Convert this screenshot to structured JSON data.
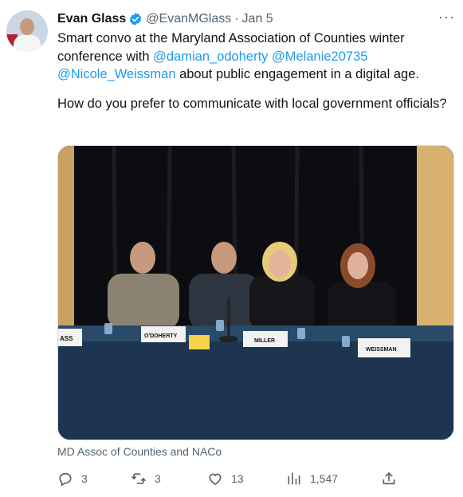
{
  "tweet": {
    "author_name": "Evan Glass",
    "handle": "@EvanMGlass",
    "separator": "·",
    "date": "Jan 5",
    "text_line1": "Smart convo at the Maryland Association of Counties winter conference with ",
    "mention1": "@damian_odoherty",
    "mention2": "@Melanie20735",
    "mention3": "@Nicole_Weissman",
    "text_after_mentions": " about public engagement in a digital age.",
    "question": "How do you prefer to communicate with local government officials?",
    "more_label": "···"
  },
  "media": {
    "nameplates": [
      "ASS",
      "O'DOHERTY",
      "MILLER",
      "WEISSMAN"
    ],
    "caption": "MD Assoc of Counties and NACo"
  },
  "actions": {
    "replies": "3",
    "retweets": "3",
    "likes": "13",
    "views": "1,547"
  },
  "colors": {
    "accent": "#1d9bf0",
    "secondary_text": "#536471",
    "primary_text": "#0f1419"
  },
  "icons": [
    "verified-badge-icon",
    "more-icon",
    "reply-icon",
    "retweet-icon",
    "like-icon",
    "views-icon",
    "share-icon"
  ]
}
